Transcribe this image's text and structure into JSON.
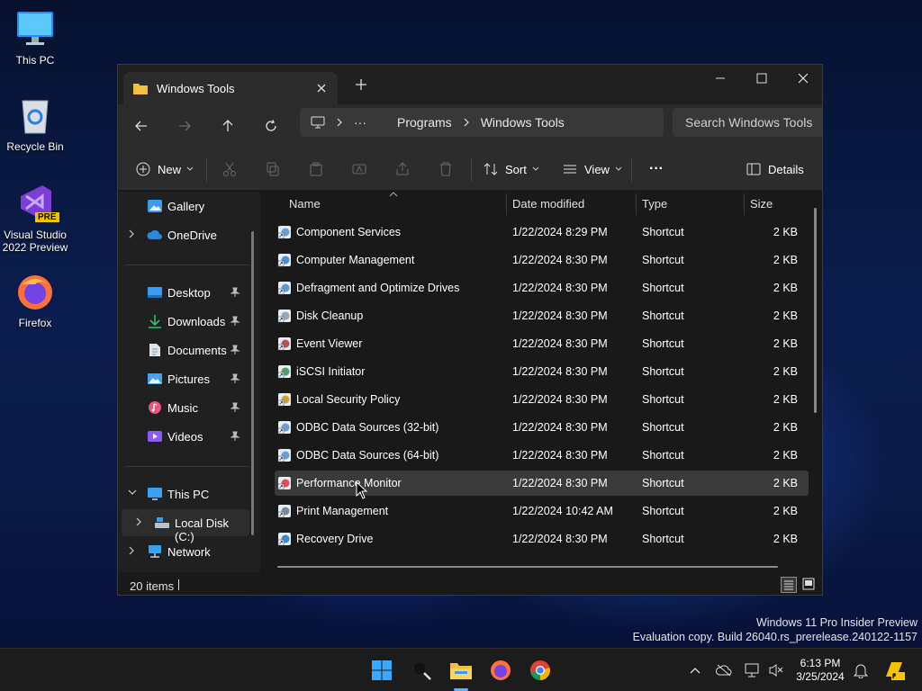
{
  "desktop": {
    "icons": [
      {
        "label": "This PC",
        "icon": "monitor-icon"
      },
      {
        "label": "Recycle Bin",
        "icon": "recycle-bin-icon"
      },
      {
        "label_line1": "Visual Studio",
        "label_line2": "2022 Preview",
        "badge": "PRE",
        "icon": "visual-studio-icon"
      },
      {
        "label": "Firefox",
        "icon": "firefox-icon"
      }
    ],
    "watermark_line1": "Windows 11 Pro Insider Preview",
    "watermark_line2": "Evaluation copy. Build 26040.rs_prerelease.240122-1157"
  },
  "window": {
    "tab_title": "Windows Tools",
    "breadcrumb": {
      "overflow": "···",
      "items": [
        "Programs",
        "Windows Tools"
      ]
    },
    "search_placeholder": "Search Windows Tools",
    "commands": {
      "new": "New",
      "sort": "Sort",
      "view": "View",
      "more": "···",
      "details": "Details"
    },
    "nav": {
      "gallery": "Gallery",
      "onedrive": "OneDrive",
      "desktop": "Desktop",
      "downloads": "Downloads",
      "documents": "Documents",
      "pictures": "Pictures",
      "music": "Music",
      "videos": "Videos",
      "this_pc": "This PC",
      "local_disk": "Local Disk (C:)",
      "network": "Network"
    },
    "columns": {
      "name": "Name",
      "date": "Date modified",
      "type": "Type",
      "size": "Size"
    },
    "files": [
      {
        "name": "Component Services",
        "date": "1/22/2024 8:29 PM",
        "type": "Shortcut",
        "size": "2 KB"
      },
      {
        "name": "Computer Management",
        "date": "1/22/2024 8:30 PM",
        "type": "Shortcut",
        "size": "2 KB"
      },
      {
        "name": "Defragment and Optimize Drives",
        "date": "1/22/2024 8:30 PM",
        "type": "Shortcut",
        "size": "2 KB"
      },
      {
        "name": "Disk Cleanup",
        "date": "1/22/2024 8:30 PM",
        "type": "Shortcut",
        "size": "2 KB"
      },
      {
        "name": "Event Viewer",
        "date": "1/22/2024 8:30 PM",
        "type": "Shortcut",
        "size": "2 KB"
      },
      {
        "name": "iSCSI Initiator",
        "date": "1/22/2024 8:30 PM",
        "type": "Shortcut",
        "size": "2 KB"
      },
      {
        "name": "Local Security Policy",
        "date": "1/22/2024 8:30 PM",
        "type": "Shortcut",
        "size": "2 KB"
      },
      {
        "name": "ODBC Data Sources (32-bit)",
        "date": "1/22/2024 8:30 PM",
        "type": "Shortcut",
        "size": "2 KB"
      },
      {
        "name": "ODBC Data Sources (64-bit)",
        "date": "1/22/2024 8:30 PM",
        "type": "Shortcut",
        "size": "2 KB"
      },
      {
        "name": "Performance Monitor",
        "date": "1/22/2024 8:30 PM",
        "type": "Shortcut",
        "size": "2 KB"
      },
      {
        "name": "Print Management",
        "date": "1/22/2024 10:42 AM",
        "type": "Shortcut",
        "size": "2 KB"
      },
      {
        "name": "Recovery Drive",
        "date": "1/22/2024 8:30 PM",
        "type": "Shortcut",
        "size": "2 KB"
      }
    ],
    "status_count": "20 items"
  },
  "taskbar": {
    "time": "6:13 PM",
    "date": "3/25/2024",
    "apps": [
      "start-icon",
      "search-icon",
      "file-explorer-icon",
      "firefox-icon",
      "chrome-icon"
    ]
  },
  "colors": {
    "accent": "#0078d4",
    "folder": "#f0c040",
    "window_bg": "#191919",
    "toolbar_bg": "#2c2c2c"
  }
}
